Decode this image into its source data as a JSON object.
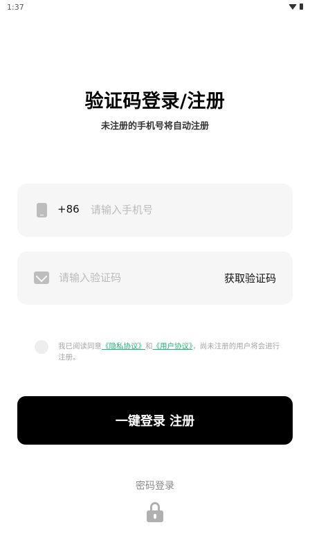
{
  "status_bar": {
    "time": "1:37",
    "icons": [
      "wifi-icon",
      "battery-icon"
    ]
  },
  "header": {
    "title": "验证码登录/注册",
    "subtitle": "未注册的手机号将自动注册"
  },
  "phone_field": {
    "icon": "phone-icon",
    "country_code": "+86",
    "placeholder": "请输入手机号",
    "value": ""
  },
  "code_field": {
    "icon": "mail-icon",
    "placeholder": "请输入验证码",
    "value": "",
    "get_code_label": "获取验证码"
  },
  "agreement": {
    "checked": false,
    "prefix": "我已阅读同意",
    "privacy_link": "《隐私协议》",
    "connector": "和",
    "user_link": "《用户协议》",
    "suffix": "，尚未注册的用户将会进行注册。",
    "link_color": "#22b573"
  },
  "login_button": {
    "label": "一键登录 注册"
  },
  "alt_login": {
    "label": "密码登录",
    "icon": "lock-icon"
  }
}
